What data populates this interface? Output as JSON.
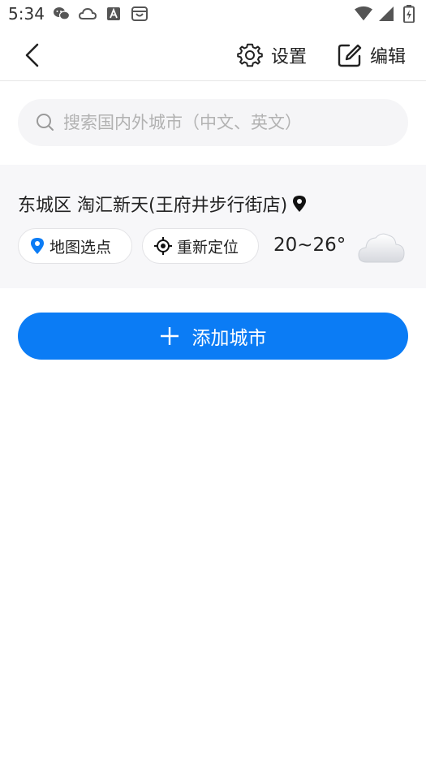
{
  "status_bar": {
    "time": "5:34",
    "left_icons": [
      "wechat-icon",
      "cloud-icon",
      "a-box-icon",
      "shop-bag-icon"
    ],
    "right_icons": [
      "wifi-icon",
      "signal-icon",
      "battery-charging-icon"
    ]
  },
  "header": {
    "settings_label": "设置",
    "edit_label": "编辑"
  },
  "search": {
    "placeholder": "搜索国内外城市（中文、英文）"
  },
  "location": {
    "title": "东城区 淘汇新天(王府井步行街店)",
    "map_pick_label": "地图选点",
    "relocate_label": "重新定位",
    "temperature": "20~26°",
    "weather_icon": "cloud-icon"
  },
  "add_city": {
    "label": "添加城市"
  },
  "colors": {
    "accent": "#0b7cf5",
    "card_bg": "#f7f7f9",
    "search_bg": "#f5f5f7"
  }
}
